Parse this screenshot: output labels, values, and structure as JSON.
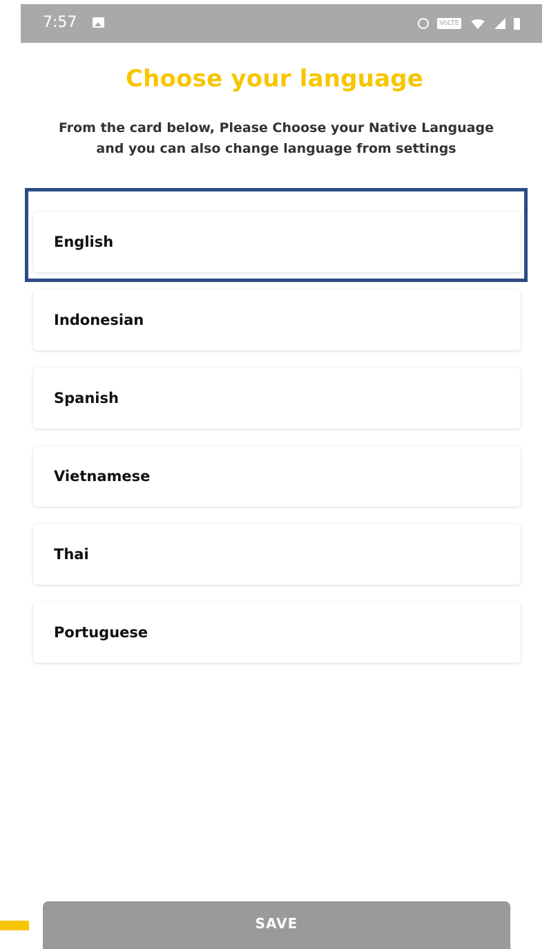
{
  "status_bar": {
    "time": "7:57",
    "volte_label": "VoLTE",
    "icons": [
      "image-icon",
      "alarm-icon",
      "volte-badge",
      "wifi-icon",
      "signal-icon",
      "battery-icon"
    ]
  },
  "header": {
    "title": "Choose your language",
    "subtitle": "From the card below, Please Choose your Native Language and you can also change language from settings"
  },
  "languages": [
    {
      "label": "English",
      "highlighted": true
    },
    {
      "label": "Indonesian",
      "highlighted": false
    },
    {
      "label": "Spanish",
      "highlighted": false
    },
    {
      "label": "Vietnamese",
      "highlighted": false
    },
    {
      "label": "Thai",
      "highlighted": false
    },
    {
      "label": "Portuguese",
      "highlighted": false
    }
  ],
  "footer": {
    "save_label": "SAVE"
  },
  "colors": {
    "accent": "#f7c600",
    "highlight_border": "#2e4b86",
    "button_disabled": "#9a9a9a",
    "status_bar": "#a9a9a9"
  }
}
